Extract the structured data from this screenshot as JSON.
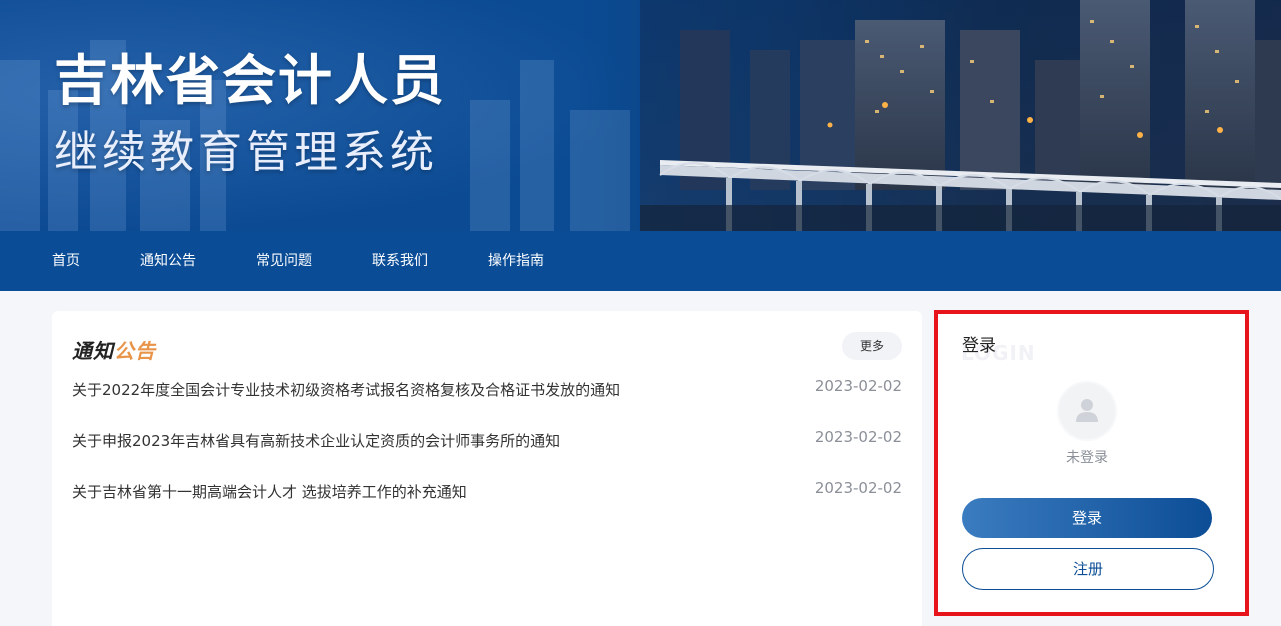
{
  "banner": {
    "title": "吉林省会计人员",
    "subtitle": "继续教育管理系统"
  },
  "nav": {
    "items": [
      {
        "label": "首页"
      },
      {
        "label": "通知公告"
      },
      {
        "label": "常见问题"
      },
      {
        "label": "联系我们"
      },
      {
        "label": "操作指南"
      }
    ]
  },
  "notices": {
    "title_part1": "通知",
    "title_part2": "公告",
    "more_label": "更多",
    "items": [
      {
        "title": "关于2022年度全国会计专业技术初级资格考试报名资格复核及合格证书发放的通知",
        "date": "2023-02-02"
      },
      {
        "title": "关于申报2023年吉林省具有高新技术企业认定资质的会计师事务所的通知",
        "date": "2023-02-02"
      },
      {
        "title": "关于吉林省第十一期高端会计人才 选拔培养工作的补充通知",
        "date": "2023-02-02"
      }
    ]
  },
  "login": {
    "heading": "登录",
    "bg_word": "LOGIN",
    "status": "未登录",
    "login_button": "登录",
    "register_button": "注册",
    "avatar_icon": "user-icon"
  },
  "colors": {
    "nav_bg": "#0a4c96",
    "accent": "#e8954a",
    "primary": "#0c4d96",
    "highlight": "#e8141b"
  }
}
